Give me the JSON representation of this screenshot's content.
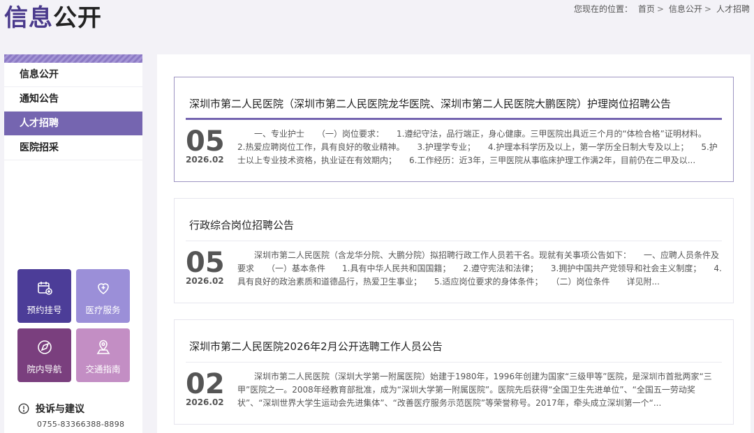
{
  "header": {
    "title_part1": "信息",
    "title_part2": "公开",
    "breadcrumb_prefix": "您现在的位置：",
    "breadcrumb": [
      "首页",
      "信息公开",
      "人才招聘"
    ],
    "breadcrumb_sep": ">"
  },
  "sidebar": {
    "items": [
      {
        "label": "信息公开",
        "active": false
      },
      {
        "label": "通知公告",
        "active": false
      },
      {
        "label": "人才招聘",
        "active": true
      },
      {
        "label": "医院招采",
        "active": false
      }
    ],
    "tiles": [
      {
        "label": "预约挂号",
        "icon": "calendar-plus-icon"
      },
      {
        "label": "医疗服务",
        "icon": "heart-plus-icon"
      },
      {
        "label": "院内导航",
        "icon": "navigation-icon"
      },
      {
        "label": "交通指南",
        "icon": "map-pin-icon"
      }
    ],
    "complaint": {
      "title": "投诉与建议",
      "phone": "0755-83366388-8898",
      "icon": "alert-circle-icon"
    }
  },
  "articles": [
    {
      "title": "深圳市第二人民医院（深圳市第二人民医院龙华医院、深圳市第二人民医院大鹏医院）护理岗位招聘公告",
      "day": "05",
      "year_month": "2026.02",
      "summary": "一、专业护士　　（一）岗位要求：　　1.遵纪守法，品行端正，身心健康。三甲医院出具近三个月的“体检合格”证明材料。　　2.热爱应聘岗位工作，具有良好的敬业精神。　　3.护理学专业；　　4.护理本科学历及以上，第一学历全日制大专及以上；　　5.护士以上专业技术资格，执业证在有效期内；　　6.工作经历：近3年，三甲医院从事临床护理工作满2年，目前仍在二甲及以..."
    },
    {
      "title": "行政综合岗位招聘公告",
      "day": "05",
      "year_month": "2026.02",
      "summary": "深圳市第二人民医院（含龙华分院、大鹏分院）拟招聘行政工作人员若干名。现就有关事项公告如下：　　一、应聘人员条件及要求　　（一）基本条件　　1.具有中华人民共和国国籍；　　2.遵守宪法和法律；　　3.拥护中国共产党领导和社会主义制度；　　4.具有良好的政治素质和道德品行，热爱卫生事业；　　5.适应岗位要求的身体条件；　　（二）岗位条件　　详见附..."
    },
    {
      "title": "深圳市第二人民医院2026年2月公开选聘工作人员公告",
      "day": "02",
      "year_month": "2026.02",
      "summary": "深圳市第二人民医院（深圳大学第一附属医院）始建于1980年，1996年创建为国家“三级甲等”医院，是深圳市首批两家“三甲”医院之一。2008年经教育部批准，成为“深圳大学第一附属医院”。医院先后获得“全国卫生先进单位”、“全国五一劳动奖状”、“深圳世界大学生运动会先进集体”、“改善医疗服务示范医院”等荣誉称号。2017年，牵头成立深圳第一个“..."
    }
  ],
  "colors": {
    "accent": "#7565b0",
    "title_accent": "#4a3a8c"
  }
}
